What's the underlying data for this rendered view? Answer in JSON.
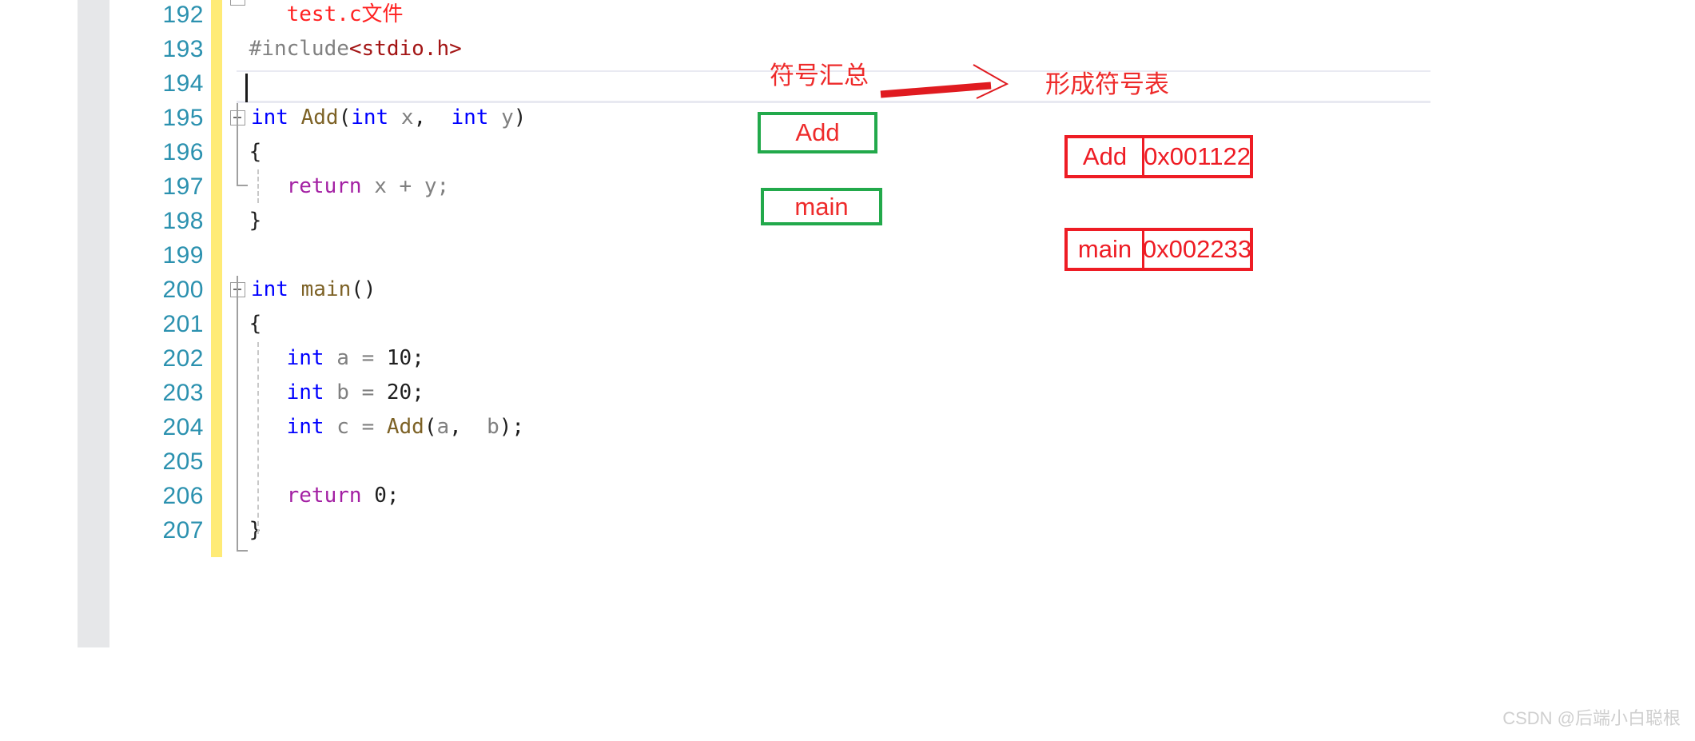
{
  "editor": {
    "language": "c",
    "first_line": 192,
    "active_line": 194,
    "colors": {
      "keyword": "#0000ff",
      "function": "#7d6226",
      "return_keyword": "#a31fa3",
      "variable": "#808080",
      "preprocessor": "#808080",
      "string_include": "#a31515",
      "line_number": "#2b91af",
      "change_bar": "#ffeb76",
      "selection_margin": "#e6e7e9",
      "current_line_band": "#e9eaf2"
    },
    "lines": [
      {
        "no": "192",
        "tokens": [
          {
            "t": "    test.c文件",
            "c": "t-cmt"
          }
        ]
      },
      {
        "no": "193",
        "tokens": [
          {
            "t": " #include",
            "c": "t-pp"
          },
          {
            "t": "<stdio.h>",
            "c": "t-str"
          }
        ]
      },
      {
        "no": "194",
        "tokens": [
          {
            "t": "",
            "c": "t-pun"
          }
        ]
      },
      {
        "no": "195",
        "tokens": [
          {
            "t": "int",
            "c": "t-kw"
          },
          {
            "t": " ",
            "c": "t-pun"
          },
          {
            "t": "Add",
            "c": "t-fn"
          },
          {
            "t": "(",
            "c": "t-pun"
          },
          {
            "t": "int",
            "c": "t-kw"
          },
          {
            "t": " ",
            "c": "t-pun"
          },
          {
            "t": "x",
            "c": "t-var"
          },
          {
            "t": ",  ",
            "c": "t-pun"
          },
          {
            "t": "int",
            "c": "t-kw"
          },
          {
            "t": " ",
            "c": "t-pun"
          },
          {
            "t": "y",
            "c": "t-var"
          },
          {
            "t": ")",
            "c": "t-pun"
          }
        ]
      },
      {
        "no": "196",
        "tokens": [
          {
            "t": " {",
            "c": "t-pun"
          }
        ]
      },
      {
        "no": "197",
        "tokens": [
          {
            "t": "    ",
            "c": "t-pun"
          },
          {
            "t": "return",
            "c": "t-ret"
          },
          {
            "t": " ",
            "c": "t-pun"
          },
          {
            "t": "x",
            "c": "t-var"
          },
          {
            "t": " ",
            "c": "t-pun"
          },
          {
            "t": "+",
            "c": "t-var"
          },
          {
            "t": " ",
            "c": "t-pun"
          },
          {
            "t": "y",
            "c": "t-var"
          },
          {
            "t": ";",
            "c": "t-var"
          }
        ]
      },
      {
        "no": "198",
        "tokens": [
          {
            "t": " }",
            "c": "t-pun"
          }
        ]
      },
      {
        "no": "199",
        "tokens": [
          {
            "t": "",
            "c": "t-pun"
          }
        ]
      },
      {
        "no": "200",
        "tokens": [
          {
            "t": "int",
            "c": "t-kw"
          },
          {
            "t": " ",
            "c": "t-pun"
          },
          {
            "t": "main",
            "c": "t-fn"
          },
          {
            "t": "()",
            "c": "t-pun"
          }
        ]
      },
      {
        "no": "201",
        "tokens": [
          {
            "t": " {",
            "c": "t-pun"
          }
        ]
      },
      {
        "no": "202",
        "tokens": [
          {
            "t": "    ",
            "c": "t-pun"
          },
          {
            "t": "int",
            "c": "t-kw"
          },
          {
            "t": " ",
            "c": "t-pun"
          },
          {
            "t": "a",
            "c": "t-var"
          },
          {
            "t": " ",
            "c": "t-pun"
          },
          {
            "t": "=",
            "c": "t-var"
          },
          {
            "t": " ",
            "c": "t-pun"
          },
          {
            "t": "10",
            "c": "t-num"
          },
          {
            "t": ";",
            "c": "t-num"
          }
        ]
      },
      {
        "no": "203",
        "tokens": [
          {
            "t": "    ",
            "c": "t-pun"
          },
          {
            "t": "int",
            "c": "t-kw"
          },
          {
            "t": " ",
            "c": "t-pun"
          },
          {
            "t": "b",
            "c": "t-var"
          },
          {
            "t": " ",
            "c": "t-pun"
          },
          {
            "t": "=",
            "c": "t-var"
          },
          {
            "t": " ",
            "c": "t-pun"
          },
          {
            "t": "20",
            "c": "t-num"
          },
          {
            "t": ";",
            "c": "t-num"
          }
        ]
      },
      {
        "no": "204",
        "tokens": [
          {
            "t": "    ",
            "c": "t-pun"
          },
          {
            "t": "int",
            "c": "t-kw"
          },
          {
            "t": " ",
            "c": "t-pun"
          },
          {
            "t": "c",
            "c": "t-var"
          },
          {
            "t": " ",
            "c": "t-pun"
          },
          {
            "t": "=",
            "c": "t-var"
          },
          {
            "t": " ",
            "c": "t-pun"
          },
          {
            "t": "Add",
            "c": "t-fn"
          },
          {
            "t": "(",
            "c": "t-pun"
          },
          {
            "t": "a",
            "c": "t-var"
          },
          {
            "t": ",  ",
            "c": "t-pun"
          },
          {
            "t": "b",
            "c": "t-var"
          },
          {
            "t": ");",
            "c": "t-pun"
          }
        ]
      },
      {
        "no": "205",
        "tokens": [
          {
            "t": "",
            "c": "t-pun"
          }
        ]
      },
      {
        "no": "206",
        "tokens": [
          {
            "t": "    ",
            "c": "t-pun"
          },
          {
            "t": "return",
            "c": "t-ret"
          },
          {
            "t": " ",
            "c": "t-pun"
          },
          {
            "t": "0",
            "c": "t-num"
          },
          {
            "t": ";",
            "c": "t-num"
          }
        ]
      },
      {
        "no": "207",
        "tokens": [
          {
            "t": " }",
            "c": "t-pun"
          }
        ]
      }
    ]
  },
  "annotations": {
    "symbol_collect_label": "符号汇总",
    "symbol_table_label": "形成符号表",
    "arrow_color": "#e01b20",
    "green_boxes": [
      {
        "label": "Add"
      },
      {
        "label": "main"
      }
    ],
    "symbol_table_rows": [
      {
        "name": "Add",
        "address": "0x001122"
      },
      {
        "name": "main",
        "address": "0x002233"
      }
    ]
  },
  "watermark": {
    "text": "CSDN @后端小白聪根"
  }
}
